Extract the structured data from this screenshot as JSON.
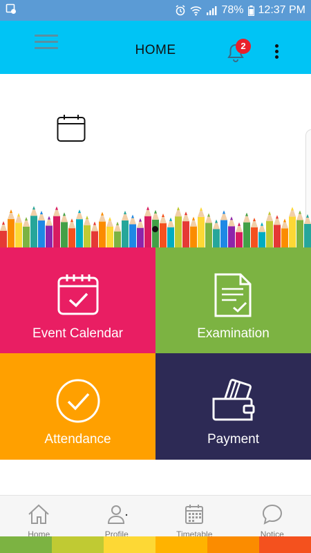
{
  "status_bar": {
    "battery": "78%",
    "time": "12:37 PM",
    "icons": [
      "screenshot-icon",
      "alarm-icon",
      "wifi-icon",
      "signal-icon",
      "battery-icon"
    ]
  },
  "app_bar": {
    "title": "HOME",
    "notification_count": "2",
    "icons": [
      "menu-icon",
      "bell-icon",
      "more-vert-icon"
    ]
  },
  "banner": {
    "image": "colored-pencils-banner",
    "icon": "calendar-icon",
    "slides": 2,
    "active_slide": 1
  },
  "tiles": [
    {
      "label": "Event Calendar",
      "icon": "calendar-check-icon",
      "color": "#e91e63"
    },
    {
      "label": "Examination",
      "icon": "document-check-icon",
      "color": "#7cb342"
    },
    {
      "label": "Attendance",
      "icon": "check-circle-icon",
      "color": "#ffa000"
    },
    {
      "label": "Payment",
      "icon": "wallet-icon",
      "color": "#2d2a55"
    }
  ],
  "bottom_nav": [
    {
      "label": "Home",
      "icon": "home-icon"
    },
    {
      "label": "Profile",
      "icon": "profile-icon"
    },
    {
      "label": "Timetable",
      "icon": "timetable-icon"
    },
    {
      "label": "Notice",
      "icon": "chat-bubble-icon"
    }
  ],
  "colors": {
    "status_bar": "#5b9bd5",
    "app_bar": "#00c4f5",
    "badge": "#e8202a",
    "strip": [
      "#7cb342",
      "#c0ca33",
      "#fdd835",
      "#ffb300",
      "#fb8c00",
      "#f4511e"
    ]
  }
}
